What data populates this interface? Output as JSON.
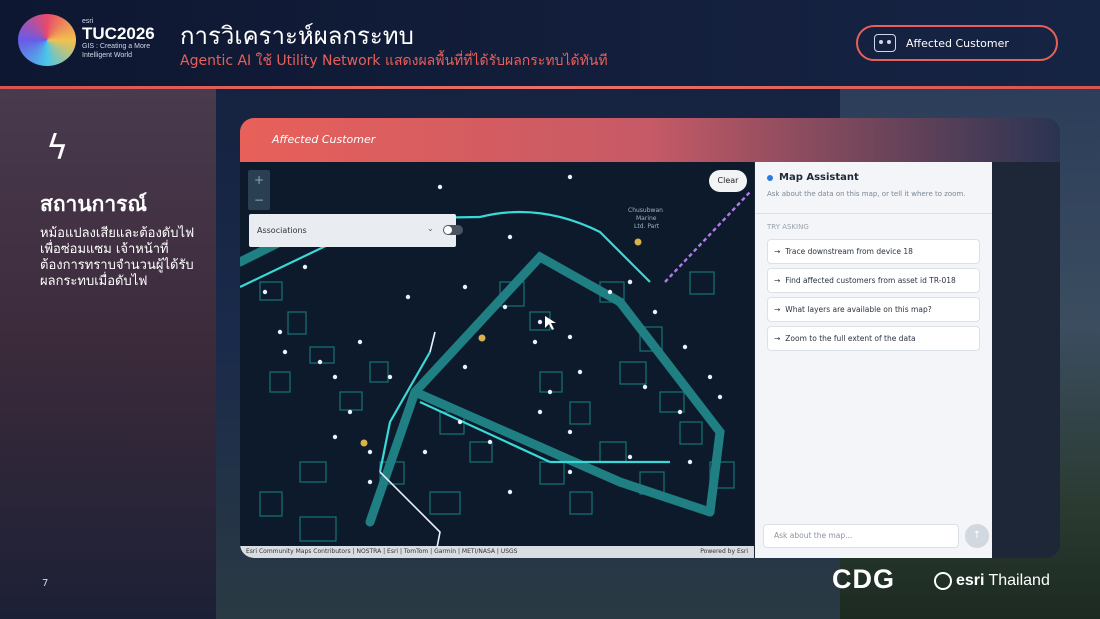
{
  "header": {
    "logo": {
      "esri": "esri",
      "tuc": "TUC2026",
      "tagline": "GIS : Creating a More Intelligent World"
    },
    "title": "การวิเคราะห์ผลกระทบ",
    "subtitle": "Agentic AI ใช้ Utility Network แสดงผลพื้นที่ที่ได้รับผลกระทบได้ทันที",
    "pill_label": "Affected Customer"
  },
  "left": {
    "heading": "สถานการณ์",
    "description": "หม้อแปลงเสียและต้องดับไฟเพื่อซ่อมแซม เจ้าหน้าที่ต้องการทราบจำนวนผู้ได้รับผลกระทบเมื่อดับไฟ",
    "page_number": "7"
  },
  "card": {
    "header_label": "Affected Customer",
    "map": {
      "zoom_in": "+",
      "zoom_out": "−",
      "associations_label": "Associations",
      "clear_label": "Clear",
      "place_label": "Chusubwan Marine Ltd. Part",
      "attribution": "Esri Community Maps Contributors | NOSTRA | Esri | TomTom | Garmin | METI/NASA | USGS",
      "powered_by": "Powered by Esri"
    },
    "assistant": {
      "title": "Map Assistant",
      "subtitle": "Ask about the data on this map, or tell it where to zoom.",
      "try_label": "TRY ASKING",
      "suggestions": [
        "Trace downstream from device 18",
        "Find affected customers from asset id TR-018",
        "What layers are available on this map?",
        "Zoom to the full extent of the data"
      ],
      "input_placeholder": "Ask about the map...",
      "send_icon": "arrow-up-icon"
    }
  },
  "footer": {
    "cdg": "CDG",
    "esri": "esri",
    "thailand": "Thailand"
  },
  "colors": {
    "accent": "#e8605a",
    "map_bg": "#0d1a2b",
    "network": "#1fb8b8"
  }
}
